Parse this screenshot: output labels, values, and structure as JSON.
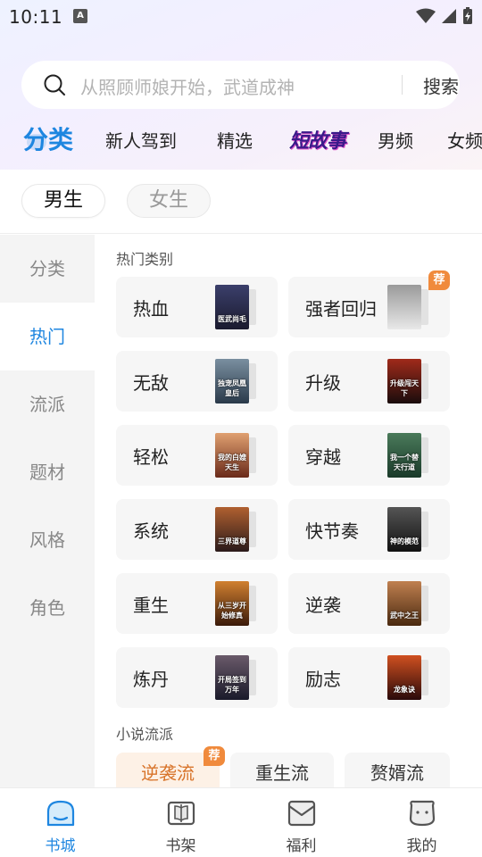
{
  "status_bar": {
    "time": "10:11",
    "notification_letter": "A"
  },
  "search": {
    "placeholder": "从照顾师娘开始，武道成神",
    "button_label": "搜索"
  },
  "top_tabs": [
    {
      "label": "分类",
      "active": true
    },
    {
      "label": "新人驾到"
    },
    {
      "label": "精选"
    },
    {
      "label": "短故事"
    },
    {
      "label": "男频"
    },
    {
      "label": "女频"
    }
  ],
  "gender": {
    "male": "男生",
    "female": "女生",
    "selected": "男生"
  },
  "left_nav": [
    "分类",
    "热门",
    "流派",
    "题材",
    "风格",
    "角色"
  ],
  "left_nav_active": "热门",
  "sections": {
    "hot_categories_title": "热门类别",
    "novel_styles_title": "小说流派"
  },
  "categories": [
    {
      "label": "热血",
      "cover_text": "医武尚毛",
      "cover_colors": [
        "#1a1a2e",
        "#3b3f6b"
      ]
    },
    {
      "label": "强者回归",
      "cover_text": "",
      "cover_colors": [
        "#e8e8e8",
        "#9a9a9a"
      ],
      "badge": "荐"
    },
    {
      "label": "无敌",
      "cover_text": "独宠凤凰皇后",
      "cover_colors": [
        "#2a3a4a",
        "#7a8fa0"
      ]
    },
    {
      "label": "升级",
      "cover_text": "升级闯天下",
      "cover_colors": [
        "#1a0c0c",
        "#a02a1a"
      ]
    },
    {
      "label": "轻松",
      "cover_text": "我的白嫂天生",
      "cover_colors": [
        "#6a2a1a",
        "#e0a070"
      ]
    },
    {
      "label": "穿越",
      "cover_text": "我一个替天行道",
      "cover_colors": [
        "#1a3a2a",
        "#4a7a5a"
      ]
    },
    {
      "label": "系统",
      "cover_text": "三界道尊",
      "cover_colors": [
        "#2a1a1a",
        "#b06030"
      ]
    },
    {
      "label": "快节奏",
      "cover_text": "神的模范",
      "cover_colors": [
        "#111",
        "#555"
      ]
    },
    {
      "label": "重生",
      "cover_text": "从三岁开始修真",
      "cover_colors": [
        "#3a1a0a",
        "#d08030"
      ]
    },
    {
      "label": "逆袭",
      "cover_text": "武中之王",
      "cover_colors": [
        "#4a2a10",
        "#c08050"
      ]
    },
    {
      "label": "炼丹",
      "cover_text": "开局签到万年",
      "cover_colors": [
        "#1a1a2a",
        "#6a5a6a"
      ]
    },
    {
      "label": "励志",
      "cover_text": "龙象诀",
      "cover_colors": [
        "#2a0a0a",
        "#d05020"
      ]
    }
  ],
  "category_badge": "荐",
  "styles": [
    {
      "label": "逆袭流",
      "hot": true
    },
    {
      "label": "重生流"
    },
    {
      "label": "赘婿流"
    }
  ],
  "bottom_nav": [
    {
      "label": "书城",
      "icon": "bookstore-icon",
      "active": true
    },
    {
      "label": "书架",
      "icon": "bookshelf-icon"
    },
    {
      "label": "福利",
      "icon": "gift-icon"
    },
    {
      "label": "我的",
      "icon": "profile-icon"
    }
  ],
  "colors": {
    "accent": "#1e86e0",
    "badge": "#f08a3c",
    "hot_style_text": "#d8742a"
  }
}
